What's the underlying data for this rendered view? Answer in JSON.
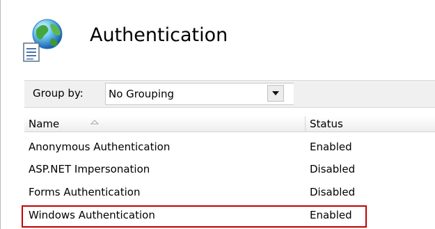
{
  "header": {
    "title": "Authentication",
    "icon": "authentication-globe-document-icon"
  },
  "toolbar": {
    "group_by_label": "Group by:",
    "group_by_value": "No Grouping",
    "dropdown_icon": "chevron-down-icon"
  },
  "table": {
    "columns": [
      {
        "label": "Name",
        "sort": "ascending"
      },
      {
        "label": "Status"
      }
    ],
    "rows": [
      {
        "name": "Anonymous Authentication",
        "status": "Enabled"
      },
      {
        "name": "ASP.NET Impersonation",
        "status": "Disabled"
      },
      {
        "name": "Forms Authentication",
        "status": "Disabled"
      },
      {
        "name": "Windows Authentication",
        "status": "Enabled",
        "highlighted": true
      }
    ]
  },
  "colors": {
    "highlight_border": "#c00000",
    "toolbar_bg": "#f0f0f0"
  }
}
